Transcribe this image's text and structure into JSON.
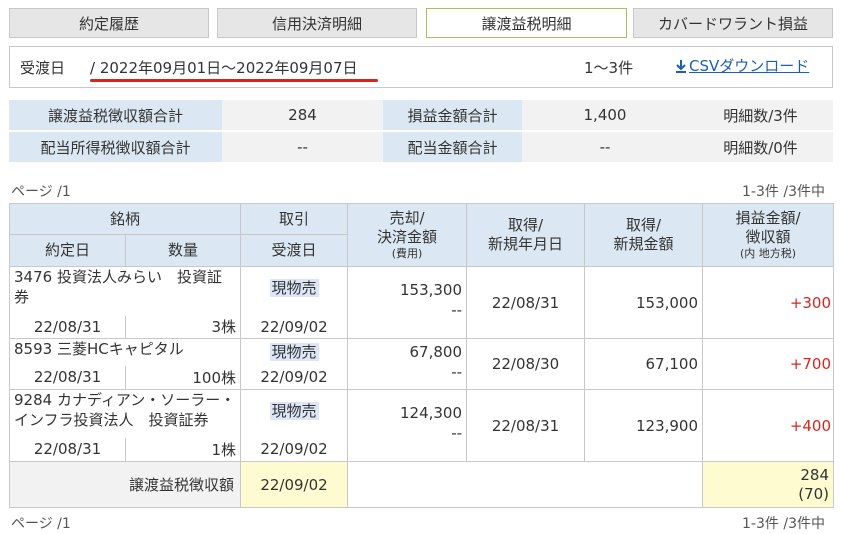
{
  "tabs": [
    {
      "label": "約定履歴"
    },
    {
      "label": "信用決済明細"
    },
    {
      "label": "譲渡益税明細"
    },
    {
      "label": "カバードワラント損益"
    }
  ],
  "filter": {
    "label": "受渡日",
    "range": "/ 2022年09月01日～2022年09月07日",
    "count": "1～3件",
    "csv_label": "CSVダウンロード"
  },
  "summary": {
    "rows": [
      {
        "h1": "譲渡益税徴収額合計",
        "v1": "284",
        "h2": "損益金額合計",
        "v2": "1,400",
        "v3": "明細数/3件"
      },
      {
        "h1": "配当所得税徴収額合計",
        "v1": "--",
        "h2": "配当金額合計",
        "v2": "--",
        "v3": "明細数/0件"
      }
    ]
  },
  "paging": {
    "top_left": "ページ /1",
    "top_right": "1-3件 /3件中",
    "bottom_left": "ページ /1",
    "bottom_right": "1-3件 /3件中"
  },
  "table": {
    "headers": {
      "stock": "銘柄",
      "trade": "取引",
      "sale1": "売却/",
      "sale2": "決済金額",
      "sale3": "(費用)",
      "acq1a": "取得/",
      "acq1b": "新規年月日",
      "acq2a": "取得/",
      "acq2b": "新規金額",
      "pl1": "損益金額/",
      "pl2": "徴収額",
      "pl3": "(内 地方税)",
      "contract_date": "約定日",
      "qty": "数量",
      "delivery": "受渡日"
    },
    "rows": [
      {
        "name": "3476 投資法人みらい　投資証券",
        "trade": "現物売",
        "sale": "153,300",
        "cost": "--",
        "acq_date": "22/08/31",
        "acq_amount": "153,000",
        "pl": "+300",
        "contract_date": "22/08/31",
        "qty": "3株",
        "delivery": "22/09/02"
      },
      {
        "name": "8593 三菱HCキャピタル",
        "trade": "現物売",
        "sale": "67,800",
        "cost": "--",
        "acq_date": "22/08/30",
        "acq_amount": "67,100",
        "pl": "+700",
        "contract_date": "22/08/31",
        "qty": "100株",
        "delivery": "22/09/02"
      },
      {
        "name": "9284 カナディアン・ソーラー・インフラ投資法人　投資証券",
        "trade": "現物売",
        "sale": "124,300",
        "cost": "--",
        "acq_date": "22/08/31",
        "acq_amount": "123,900",
        "pl": "+400",
        "contract_date": "22/08/31",
        "qty": "1株",
        "delivery": "22/09/02"
      }
    ],
    "tax_row": {
      "label": "譲渡益税徴収額",
      "date": "22/09/02",
      "amount": "284",
      "local": "(70)"
    }
  },
  "colors": {
    "profit": "#d9241c",
    "header_bg": "#dbe8f3",
    "highlight": "#fdfbcf",
    "link": "#1a5fb4"
  }
}
